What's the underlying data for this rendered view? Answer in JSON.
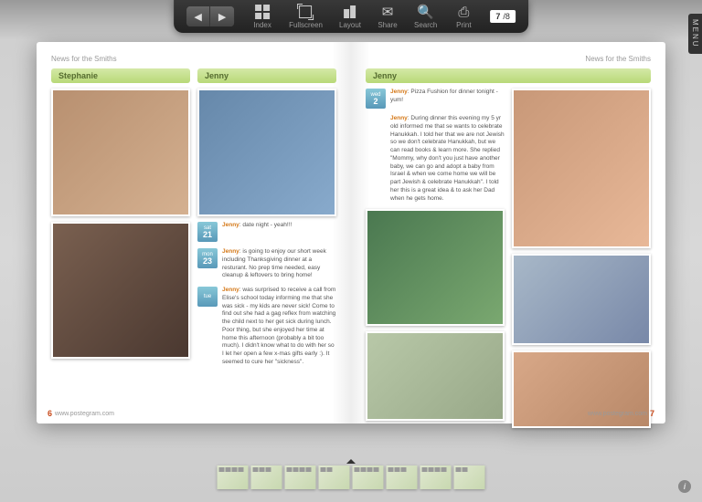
{
  "toolbar": {
    "index": "Index",
    "fullscreen": "Fullscreen",
    "layout": "Layout",
    "share": "Share",
    "search": "Search",
    "print": "Print",
    "page_current": "7",
    "page_total": "/8"
  },
  "menu_tab": "MENU",
  "header_left": "News for the Smiths",
  "header_right": "News for the Smiths",
  "left_page": {
    "sections": [
      {
        "title": "Stephanie"
      },
      {
        "title": "Jenny"
      }
    ],
    "entries": [
      {
        "day_name": "sat",
        "day_num": "21",
        "author": "Jenny",
        "text": "date night - yeah!!!"
      },
      {
        "day_name": "mon",
        "day_num": "23",
        "author": "Jenny",
        "text": "is going to enjoy our short week including Thanksgiving dinner at a resturant. No prep time needed, easy cleanup & leftovers to bring home!"
      },
      {
        "day_name": "tue",
        "day_num": "",
        "author": "Jenny",
        "text": "was surprised to receive a call from Elise's school today informing me that she was sick - my kids are never sick! Come to find out she had a gag reflex from watching the child next to her get sick during lunch. Poor thing, but she enjoyed her time at home this afternoon (probably a bit too much). I didn't know what to do with her so I let her open a few x-mas gifts early :). It seemed to cure her \"sickness\"."
      }
    ],
    "footer_url": "www.postegram.com",
    "page_num": "6"
  },
  "right_page": {
    "sections": [
      {
        "title": "Jenny"
      }
    ],
    "entries": [
      {
        "day_name": "wed",
        "day_num": "2",
        "author": "Jenny",
        "text": "Pizza Fushion for dinner tonight - yum!"
      },
      {
        "day_name": "",
        "day_num": "",
        "author": "Jenny",
        "text": "During dinner this evening my 5 yr old informed me that se wants to celebrate Hanukkah. I told her that we are not Jewish so we don't celebrate Hanukkah, but we can read books & learn more. She replied \"Mommy, why don't you just have another baby, we can go and adopt a baby from Israel & when we come home we will be part Jewish & celebrate Hanukkah\". I told her this is a great idea & to ask her Dad when he gets home."
      }
    ],
    "footer_url": "www.postegram.com",
    "page_num": "7"
  },
  "info_icon": "i"
}
